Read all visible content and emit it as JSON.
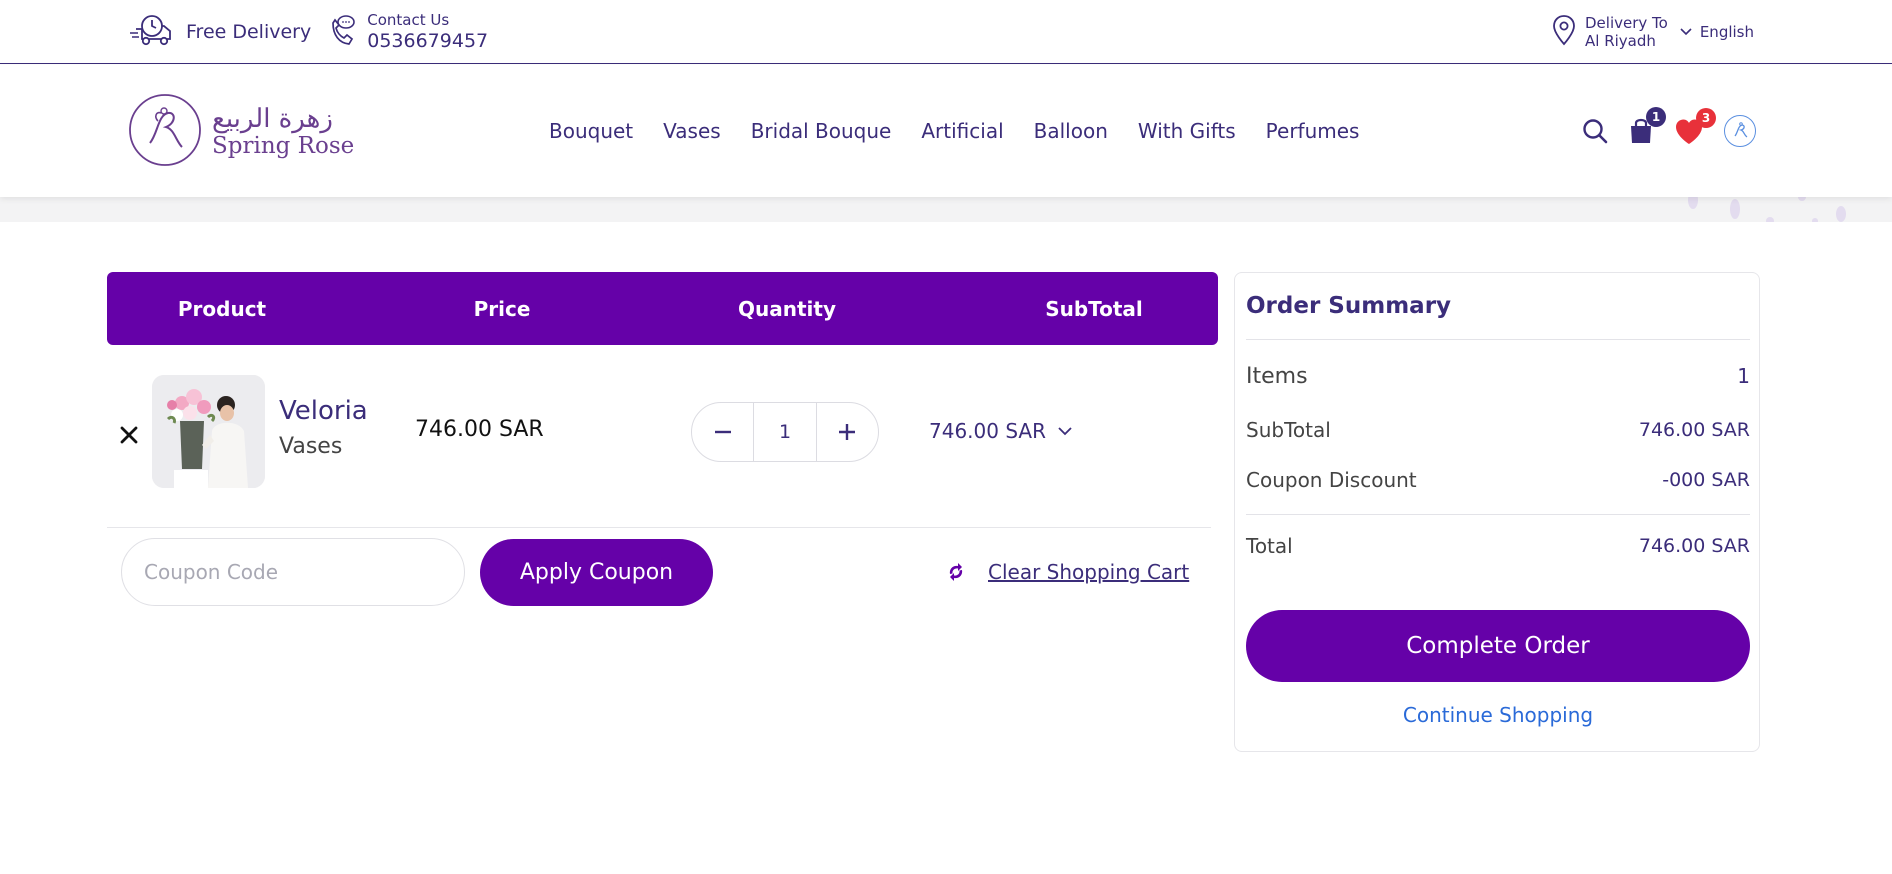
{
  "topbar": {
    "free_delivery": "Free Delivery",
    "contact_label": "Contact Us",
    "contact_phone": "0536679457",
    "delivery_to_label": "Delivery To",
    "delivery_city": "Al Riyadh",
    "language": "English"
  },
  "header": {
    "logo_arabic": "زهرة الربيع",
    "logo_english": "Spring Rose",
    "nav": [
      "Bouquet",
      "Vases",
      "Bridal Bouque",
      "Artificial",
      "Balloon",
      "With Gifts",
      "Perfumes"
    ],
    "cart_count": "1",
    "wishlist_count": "3"
  },
  "cart": {
    "headers": {
      "product": "Product",
      "price": "Price",
      "quantity": "Quantity",
      "subtotal": "SubTotal"
    },
    "items": [
      {
        "name": "Veloria",
        "category": "Vases",
        "price": "746.00 SAR",
        "quantity": "1",
        "subtotal": "746.00 SAR"
      }
    ],
    "coupon_placeholder": "Coupon Code",
    "apply_coupon": "Apply Coupon",
    "clear_cart": "Clear Shopping Cart"
  },
  "summary": {
    "title": "Order Summary",
    "items_label": "Items",
    "items_value": "1",
    "subtotal_label": "SubTotal",
    "subtotal_value": "746.00 SAR",
    "discount_label": "Coupon Discount",
    "discount_value": "-000 SAR",
    "total_label": "Total",
    "total_value": "746.00 SAR",
    "complete_order": "Complete Order",
    "continue_shopping": "Continue Shopping"
  },
  "colors": {
    "brand_purple": "#6501a8",
    "text_navy": "#3b2d7a",
    "link_blue": "#2a6ad8",
    "wishlist_red": "#e8313a"
  }
}
